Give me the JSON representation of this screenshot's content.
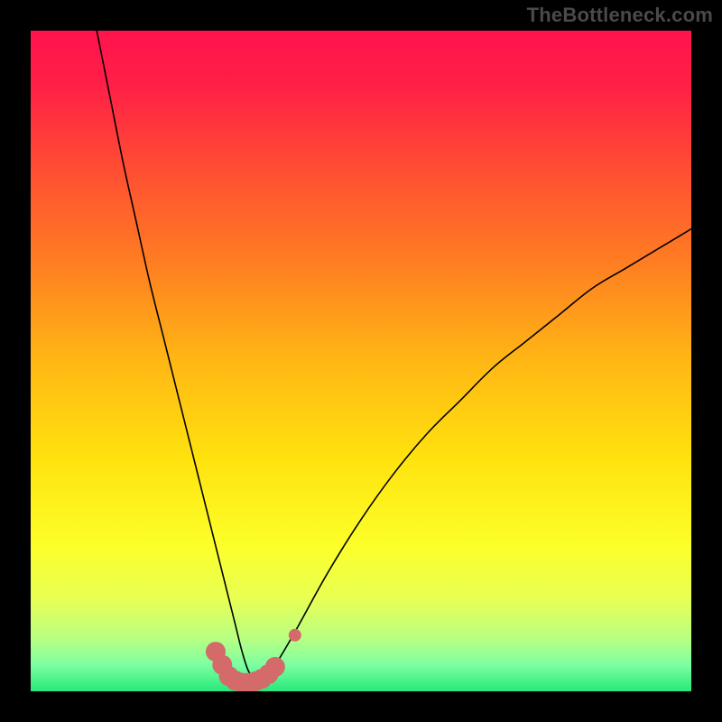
{
  "watermark": "TheBottleneck.com",
  "chart_data": {
    "type": "line",
    "title": "",
    "xlabel": "",
    "ylabel": "",
    "xlim": [
      0,
      100
    ],
    "ylim": [
      0,
      100
    ],
    "background_gradient": {
      "stops": [
        {
          "pos": 0.0,
          "color": "#ff144d"
        },
        {
          "pos": 0.08,
          "color": "#ff1f47"
        },
        {
          "pos": 0.2,
          "color": "#ff4a34"
        },
        {
          "pos": 0.35,
          "color": "#ff7d22"
        },
        {
          "pos": 0.5,
          "color": "#ffb714"
        },
        {
          "pos": 0.65,
          "color": "#ffe30e"
        },
        {
          "pos": 0.78,
          "color": "#fcff2a"
        },
        {
          "pos": 0.86,
          "color": "#e8ff54"
        },
        {
          "pos": 0.92,
          "color": "#b8ff82"
        },
        {
          "pos": 0.96,
          "color": "#7dffa2"
        },
        {
          "pos": 1.0,
          "color": "#27e87b"
        }
      ]
    },
    "series": [
      {
        "name": "bottleneck-curve",
        "stroke": "#000000",
        "stroke_width": 1.6,
        "x": [
          10,
          12,
          14,
          16,
          18,
          20,
          22,
          24,
          26,
          28,
          29,
          30,
          31,
          32,
          33,
          34,
          35,
          37,
          40,
          45,
          50,
          55,
          60,
          65,
          70,
          75,
          80,
          85,
          90,
          95,
          100
        ],
        "values": [
          100,
          90,
          80,
          71,
          62,
          54,
          46,
          38,
          30,
          22,
          18,
          14,
          10,
          6,
          3,
          2,
          2,
          4,
          9,
          18,
          26,
          33,
          39,
          44,
          49,
          53,
          57,
          61,
          64,
          67,
          70
        ]
      }
    ],
    "markers": {
      "name": "highlight-points",
      "fill": "#d46a6a",
      "radius": 11,
      "cap_radius": 7,
      "x": [
        28.0,
        29.0,
        30.0,
        31.0,
        32.0,
        33.0,
        34.0,
        35.0,
        36.0,
        37.0,
        40.0
      ],
      "y": [
        6.0,
        4.0,
        2.3,
        1.6,
        1.3,
        1.3,
        1.5,
        1.9,
        2.6,
        3.7,
        8.5
      ],
      "end_cap_only": [
        false,
        false,
        false,
        false,
        false,
        false,
        false,
        false,
        false,
        false,
        true
      ]
    }
  }
}
